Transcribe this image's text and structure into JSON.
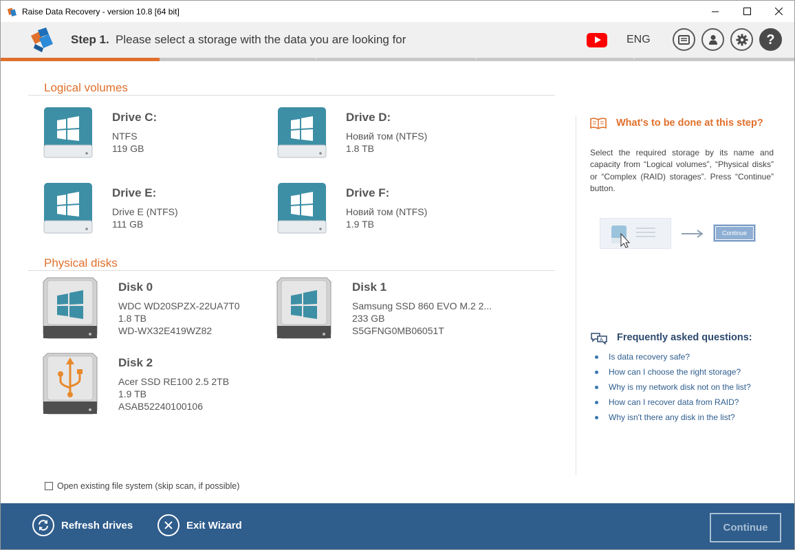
{
  "window": {
    "title": "Raise Data Recovery - version 10.8 [64 bit]"
  },
  "header": {
    "step_label": "Step 1.",
    "step_text": "Please select a storage with the data you are looking for",
    "language": "ENG",
    "progress_fraction": 0.2
  },
  "logical": {
    "title": "Logical volumes",
    "drives": [
      {
        "name": "Drive C:",
        "fs": "NTFS",
        "size": "119 GB"
      },
      {
        "name": "Drive D:",
        "fs": "Новий том (NTFS)",
        "size": "1.8 TB"
      },
      {
        "name": "Drive E:",
        "fs": "Drive E (NTFS)",
        "size": "111 GB"
      },
      {
        "name": "Drive F:",
        "fs": "Новий том (NTFS)",
        "size": "1.9 TB"
      }
    ]
  },
  "physical": {
    "title": "Physical disks",
    "disks": [
      {
        "name": "Disk 0",
        "model": "WDC WD20SPZX-22UA7T0",
        "size": "1.8 TB",
        "serial": "WD-WX32E419WZ82"
      },
      {
        "name": "Disk 1",
        "model": "Samsung SSD 860 EVO M.2 2...",
        "size": "233 GB",
        "serial": "S5GFNG0MB06051T"
      },
      {
        "name": "Disk 2",
        "model": "Acer SSD RE100 2.5 2TB",
        "size": "1.9 TB",
        "serial": "ASAB52240100106"
      }
    ]
  },
  "help": {
    "heading": "What's to be done at this step?",
    "text": "Select the required storage by its name and capacity from “Logical volumes”, “Physical disks” or “Complex (RAID) storages”. Press “Continue” button.",
    "demo_button": "Continue"
  },
  "faq": {
    "heading": "Frequently asked questions:",
    "items": [
      "Is data recovery safe?",
      "How can I choose the right storage?",
      "Why is my network disk not on the list?",
      "How can I recover data from RAID?",
      "Why isn't there any disk in the list?"
    ]
  },
  "options": {
    "open_fs_label": "Open existing file system (skip scan, if possible)"
  },
  "footer": {
    "refresh": "Refresh drives",
    "exit": "Exit Wizard",
    "continue": "Continue"
  },
  "colors": {
    "accent": "#e0702c",
    "footer": "#2f5d8c",
    "drive_teal": "#3d8fa5"
  }
}
